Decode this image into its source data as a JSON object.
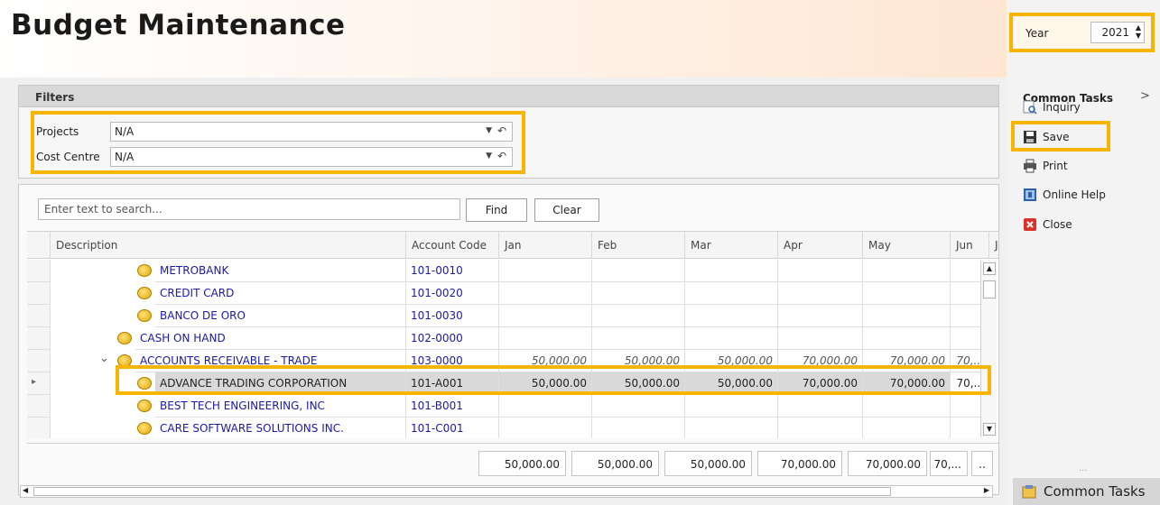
{
  "header": {
    "title": "Budget Maintenance"
  },
  "year": {
    "label": "Year",
    "value": "2021"
  },
  "sidebar": {
    "title": "Common Tasks",
    "chevron": ">",
    "items": [
      {
        "label": "Inquiry",
        "icon": "inquiry-icon"
      },
      {
        "label": "Save",
        "icon": "save-icon"
      },
      {
        "label": "Print",
        "icon": "print-icon"
      },
      {
        "label": "Online Help",
        "icon": "help-icon"
      },
      {
        "label": "Close",
        "icon": "close-icon"
      }
    ],
    "dots": "...",
    "footer": "Common Tasks"
  },
  "filters": {
    "title": "Filters",
    "projects": {
      "label": "Projects",
      "value": "N/A"
    },
    "cost_centre": {
      "label": "Cost Centre",
      "value": "N/A"
    }
  },
  "search": {
    "placeholder": "Enter text to search...",
    "find": "Find",
    "clear": "Clear"
  },
  "grid": {
    "columns": [
      "Description",
      "Account Code",
      "Jan",
      "Feb",
      "Mar",
      "Apr",
      "May",
      "Jun",
      "Jul"
    ],
    "rows": [
      {
        "desc": "METROBANK",
        "code": "101-0010",
        "vals": [
          "",
          "",
          "",
          "",
          "",
          ""
        ]
      },
      {
        "desc": "CREDIT CARD",
        "code": "101-0020",
        "vals": [
          "",
          "",
          "",
          "",
          "",
          ""
        ]
      },
      {
        "desc": "BANCO DE ORO",
        "code": "101-0030",
        "vals": [
          "",
          "",
          "",
          "",
          "",
          ""
        ]
      },
      {
        "desc": "CASH ON HAND",
        "code": "102-0000",
        "vals": [
          "",
          "",
          "",
          "",
          "",
          ""
        ]
      },
      {
        "desc": "ACCOUNTS RECEIVABLE - TRADE",
        "code": "103-0000",
        "vals": [
          "50,000.00",
          "50,000.00",
          "50,000.00",
          "70,000.00",
          "70,000.00",
          "70,..."
        ]
      },
      {
        "desc": "ADVANCE TRADING CORPORATION",
        "code": "101-A001",
        "vals": [
          "50,000.00",
          "50,000.00",
          "50,000.00",
          "70,000.00",
          "70,000.00",
          "70,..."
        ]
      },
      {
        "desc": "BEST TECH ENGINEERING, INC",
        "code": "101-B001",
        "vals": [
          "",
          "",
          "",
          "",
          "",
          ""
        ]
      },
      {
        "desc": "CARE SOFTWARE SOLUTIONS INC.",
        "code": "101-C001",
        "vals": [
          "",
          "",
          "",
          "",
          "",
          ""
        ]
      }
    ],
    "totals": [
      "50,000.00",
      "50,000.00",
      "50,000.00",
      "70,000.00",
      "70,000.00",
      "70,...",
      ".."
    ],
    "row_indicator": "▸",
    "expander": "⌄"
  },
  "colors": {
    "highlight": "#f7b500",
    "link": "#1a1aaa"
  }
}
